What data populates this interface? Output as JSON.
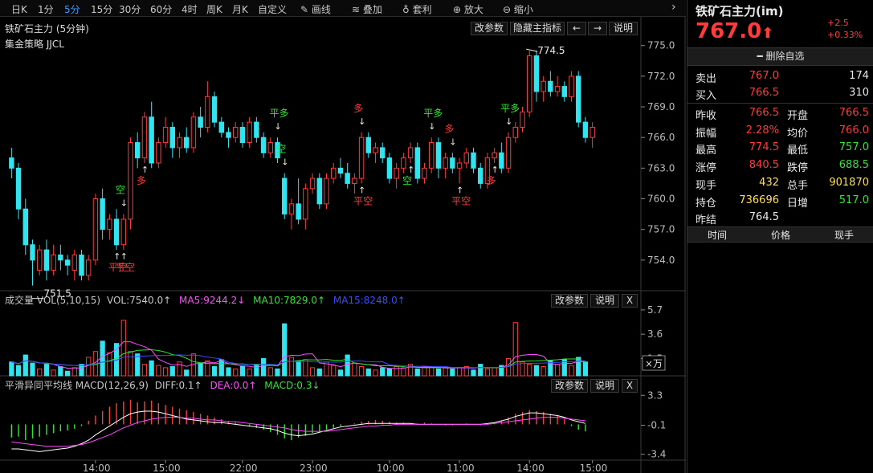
{
  "toolbar": {
    "items": [
      "日K",
      "1分",
      "5分",
      "15分",
      "30分",
      "60分",
      "4时",
      "周K",
      "月K",
      "自定义"
    ],
    "active_index": 2,
    "tools": [
      {
        "label": "画线",
        "icon": "pencil-icon"
      },
      {
        "label": "叠加",
        "icon": "stack-icon"
      },
      {
        "label": "套利",
        "icon": "moneybag-icon"
      },
      {
        "label": "放大",
        "icon": "zoom-in-icon"
      },
      {
        "label": "缩小",
        "icon": "zoom-out-icon"
      }
    ],
    "collapse_icon": "chevron-right-icon"
  },
  "main_panel": {
    "title": "铁矿石主力 (5分钟)",
    "strategy": "集金策略 JJCL",
    "buttons": {
      "params": "改参数",
      "hide_indicator": "隐藏主指标",
      "prev": "←",
      "next": "→",
      "help": "说明"
    }
  },
  "volume_panel": {
    "legend": [
      {
        "text": "成交量 VOL(5,10,15)",
        "color": "#dcdcdc"
      },
      {
        "text": "VOL:7540.0↑",
        "color": "#dcdcdc"
      },
      {
        "text": "MA5:9244.2↓",
        "color": "#ff4cff"
      },
      {
        "text": "MA10:7829.0↑",
        "color": "#2ee82e"
      },
      {
        "text": "MA15:8248.0↑",
        "color": "#3a4cff"
      }
    ],
    "buttons": {
      "params": "改参数",
      "help": "说明",
      "close": "X"
    },
    "unit": "×万"
  },
  "macd_panel": {
    "legend": [
      {
        "text": "平滑异同平均线 MACD(12,26,9)",
        "color": "#dcdcdc"
      },
      {
        "text": "DIFF:0.1↑",
        "color": "#dcdcdc"
      },
      {
        "text": "DEA:0.0↑",
        "color": "#ff4cff"
      },
      {
        "text": "MACD:0.3↓",
        "color": "#2ee82e"
      }
    ],
    "buttons": {
      "params": "改参数",
      "help": "说明",
      "close": "X"
    }
  },
  "chart_data": {
    "type": "candlestick",
    "price_axis": {
      "ticks": [
        "775.0",
        "772.0",
        "769.0",
        "766.0",
        "763.0",
        "760.0",
        "757.0",
        "754.0"
      ],
      "ylim": [
        751,
        776
      ]
    },
    "volume_axis": {
      "ticks": [
        "5.7",
        "3.6",
        "1.5"
      ]
    },
    "macd_axis": {
      "ticks": [
        "3.3",
        "-0.1",
        "-3.4"
      ]
    },
    "time_axis": [
      "14:00",
      "15:00",
      "22:00",
      "23:00",
      "10:00",
      "11:00",
      "14:00",
      "15:00"
    ],
    "annotations": {
      "high": "774.5",
      "low": "751.5"
    },
    "signals": [
      {
        "text": "平空",
        "color": "#ff3b3b"
      },
      {
        "text": "空",
        "color": "#2ee82e"
      },
      {
        "text": "平空",
        "color": "#ff3b3b"
      },
      {
        "text": "多",
        "color": "#ff3b3b"
      },
      {
        "text": "平多",
        "color": "#2ee82e"
      },
      {
        "text": "空",
        "color": "#2ee82e"
      },
      {
        "text": "多",
        "color": "#ff3b3b"
      },
      {
        "text": "平空",
        "color": "#ff3b3b"
      },
      {
        "text": "空",
        "color": "#2ee82e"
      },
      {
        "text": "平多",
        "color": "#2ee82e"
      },
      {
        "text": "多",
        "color": "#ff3b3b"
      },
      {
        "text": "平空",
        "color": "#ff3b3b"
      },
      {
        "text": "平多",
        "color": "#2ee82e"
      },
      {
        "text": "多",
        "color": "#ff3b3b"
      }
    ],
    "candles": [
      {
        "o": 764.0,
        "h": 765.0,
        "l": 762.0,
        "c": 763.0
      },
      {
        "o": 763.0,
        "h": 763.5,
        "l": 758.0,
        "c": 759.0
      },
      {
        "o": 759.0,
        "h": 760.0,
        "l": 754.5,
        "c": 755.5
      },
      {
        "o": 755.5,
        "h": 756.0,
        "l": 751.5,
        "c": 754.0
      },
      {
        "o": 753.0,
        "h": 755.5,
        "l": 752.5,
        "c": 755.0
      },
      {
        "o": 755.0,
        "h": 756.0,
        "l": 752.0,
        "c": 753.0
      },
      {
        "o": 753.0,
        "h": 755.5,
        "l": 752.5,
        "c": 754.5
      },
      {
        "o": 754.5,
        "h": 755.5,
        "l": 753.0,
        "c": 754.0
      },
      {
        "o": 754.0,
        "h": 754.5,
        "l": 752.5,
        "c": 753.5
      },
      {
        "o": 753.0,
        "h": 755.0,
        "l": 752.0,
        "c": 754.5
      },
      {
        "o": 754.5,
        "h": 755.0,
        "l": 752.0,
        "c": 752.5
      },
      {
        "o": 752.5,
        "h": 754.5,
        "l": 752.0,
        "c": 754.0
      },
      {
        "o": 754.0,
        "h": 760.5,
        "l": 753.5,
        "c": 760.0
      },
      {
        "o": 760.0,
        "h": 761.0,
        "l": 756.0,
        "c": 757.0
      },
      {
        "o": 757.0,
        "h": 758.5,
        "l": 756.0,
        "c": 758.0
      },
      {
        "o": 758.0,
        "h": 759.0,
        "l": 755.0,
        "c": 755.5
      },
      {
        "o": 755.5,
        "h": 758.5,
        "l": 755.0,
        "c": 758.0
      },
      {
        "o": 758.0,
        "h": 766.0,
        "l": 757.0,
        "c": 765.5
      },
      {
        "o": 765.5,
        "h": 766.5,
        "l": 763.0,
        "c": 764.0
      },
      {
        "o": 764.0,
        "h": 768.5,
        "l": 763.5,
        "c": 768.0
      },
      {
        "o": 768.0,
        "h": 769.5,
        "l": 763.0,
        "c": 763.5
      },
      {
        "o": 763.5,
        "h": 766.0,
        "l": 763.0,
        "c": 765.5
      },
      {
        "o": 765.5,
        "h": 768.0,
        "l": 765.0,
        "c": 767.0
      },
      {
        "o": 767.0,
        "h": 767.5,
        "l": 764.0,
        "c": 765.0
      },
      {
        "o": 765.0,
        "h": 766.5,
        "l": 764.0,
        "c": 766.0
      },
      {
        "o": 766.0,
        "h": 767.0,
        "l": 764.5,
        "c": 765.0
      },
      {
        "o": 765.0,
        "h": 768.5,
        "l": 764.5,
        "c": 768.0
      },
      {
        "o": 768.0,
        "h": 769.0,
        "l": 766.0,
        "c": 767.0
      },
      {
        "o": 767.0,
        "h": 771.5,
        "l": 766.5,
        "c": 770.0
      },
      {
        "o": 770.0,
        "h": 770.5,
        "l": 767.0,
        "c": 767.5
      },
      {
        "o": 767.5,
        "h": 768.0,
        "l": 766.0,
        "c": 766.5
      },
      {
        "o": 766.5,
        "h": 767.0,
        "l": 765.0,
        "c": 766.0
      },
      {
        "o": 766.0,
        "h": 767.5,
        "l": 765.5,
        "c": 767.0
      },
      {
        "o": 767.0,
        "h": 767.5,
        "l": 765.0,
        "c": 765.5
      },
      {
        "o": 765.5,
        "h": 768.0,
        "l": 765.0,
        "c": 767.5
      },
      {
        "o": 767.5,
        "h": 768.0,
        "l": 765.5,
        "c": 766.0
      },
      {
        "o": 766.0,
        "h": 766.5,
        "l": 764.0,
        "c": 764.5
      },
      {
        "o": 764.5,
        "h": 766.0,
        "l": 764.0,
        "c": 765.5
      },
      {
        "o": 765.5,
        "h": 766.0,
        "l": 763.5,
        "c": 764.0
      },
      {
        "o": 762.0,
        "h": 762.5,
        "l": 758.0,
        "c": 758.5
      },
      {
        "o": 758.5,
        "h": 760.0,
        "l": 757.0,
        "c": 759.5
      },
      {
        "o": 759.5,
        "h": 762.0,
        "l": 757.5,
        "c": 758.0
      },
      {
        "o": 758.0,
        "h": 761.5,
        "l": 757.0,
        "c": 761.0
      },
      {
        "o": 761.0,
        "h": 762.5,
        "l": 760.5,
        "c": 762.0
      },
      {
        "o": 762.0,
        "h": 762.5,
        "l": 759.0,
        "c": 759.5
      },
      {
        "o": 759.5,
        "h": 762.5,
        "l": 759.0,
        "c": 762.0
      },
      {
        "o": 762.0,
        "h": 763.5,
        "l": 761.5,
        "c": 763.0
      },
      {
        "o": 763.0,
        "h": 764.0,
        "l": 762.0,
        "c": 762.5
      },
      {
        "o": 762.5,
        "h": 763.5,
        "l": 761.0,
        "c": 761.5
      },
      {
        "o": 761.5,
        "h": 762.5,
        "l": 760.5,
        "c": 762.0
      },
      {
        "o": 762.0,
        "h": 766.5,
        "l": 761.5,
        "c": 766.0
      },
      {
        "o": 766.0,
        "h": 766.5,
        "l": 764.0,
        "c": 764.5
      },
      {
        "o": 764.5,
        "h": 765.5,
        "l": 763.5,
        "c": 765.0
      },
      {
        "o": 765.0,
        "h": 765.5,
        "l": 763.5,
        "c": 764.0
      },
      {
        "o": 764.0,
        "h": 764.5,
        "l": 761.5,
        "c": 762.0
      },
      {
        "o": 762.0,
        "h": 763.5,
        "l": 761.0,
        "c": 763.0
      },
      {
        "o": 763.0,
        "h": 764.5,
        "l": 762.5,
        "c": 764.0
      },
      {
        "o": 764.0,
        "h": 765.5,
        "l": 763.5,
        "c": 765.0
      },
      {
        "o": 765.0,
        "h": 765.5,
        "l": 761.5,
        "c": 762.0
      },
      {
        "o": 762.0,
        "h": 763.5,
        "l": 761.5,
        "c": 763.0
      },
      {
        "o": 763.0,
        "h": 766.0,
        "l": 762.5,
        "c": 765.5
      },
      {
        "o": 765.5,
        "h": 766.0,
        "l": 762.0,
        "c": 763.0
      },
      {
        "o": 763.0,
        "h": 764.5,
        "l": 762.0,
        "c": 764.0
      },
      {
        "o": 764.0,
        "h": 764.5,
        "l": 762.5,
        "c": 763.0
      },
      {
        "o": 763.0,
        "h": 764.0,
        "l": 761.5,
        "c": 763.5
      },
      {
        "o": 763.5,
        "h": 765.0,
        "l": 763.0,
        "c": 764.5
      },
      {
        "o": 764.5,
        "h": 765.0,
        "l": 762.5,
        "c": 763.0
      },
      {
        "o": 763.0,
        "h": 763.5,
        "l": 761.0,
        "c": 761.5
      },
      {
        "o": 761.5,
        "h": 764.5,
        "l": 761.0,
        "c": 764.0
      },
      {
        "o": 764.0,
        "h": 765.0,
        "l": 763.5,
        "c": 764.5
      },
      {
        "o": 764.5,
        "h": 765.5,
        "l": 762.5,
        "c": 763.0
      },
      {
        "o": 763.0,
        "h": 766.5,
        "l": 762.5,
        "c": 766.0
      },
      {
        "o": 766.0,
        "h": 767.5,
        "l": 765.5,
        "c": 767.0
      },
      {
        "o": 767.0,
        "h": 769.0,
        "l": 766.5,
        "c": 768.5
      },
      {
        "o": 768.5,
        "h": 774.5,
        "l": 768.0,
        "c": 774.0
      },
      {
        "o": 774.0,
        "h": 774.5,
        "l": 769.5,
        "c": 770.5
      },
      {
        "o": 770.5,
        "h": 772.0,
        "l": 769.5,
        "c": 771.5
      },
      {
        "o": 771.5,
        "h": 772.5,
        "l": 770.0,
        "c": 770.5
      },
      {
        "o": 770.5,
        "h": 772.0,
        "l": 770.0,
        "c": 771.0
      },
      {
        "o": 771.0,
        "h": 771.5,
        "l": 769.5,
        "c": 770.0
      },
      {
        "o": 770.0,
        "h": 772.5,
        "l": 769.5,
        "c": 772.0
      },
      {
        "o": 772.0,
        "h": 772.5,
        "l": 767.0,
        "c": 767.5
      },
      {
        "o": 767.5,
        "h": 768.0,
        "l": 765.5,
        "c": 766.0
      },
      {
        "o": 766.0,
        "h": 767.5,
        "l": 765.0,
        "c": 767.0
      }
    ],
    "volumes": [
      1.2,
      0.9,
      1.8,
      1.1,
      0.6,
      1.0,
      0.5,
      0.8,
      0.4,
      0.7,
      1.0,
      1.6,
      2.1,
      3.0,
      2.0,
      2.8,
      4.8,
      2.1,
      1.9,
      1.0,
      1.3,
      0.9,
      0.7,
      0.8,
      1.2,
      0.5,
      1.9,
      1.1,
      1.3,
      0.8,
      1.4,
      0.7,
      0.6,
      0.8,
      0.6,
      0.9,
      1.5,
      0.7,
      0.6,
      4.5,
      1.6,
      1.3,
      1.4,
      0.7,
      0.6,
      1.2,
      0.9,
      0.5,
      1.8,
      1.1,
      0.8,
      0.6,
      0.5,
      0.7,
      0.6,
      0.8,
      0.7,
      1.0,
      0.6,
      0.7,
      0.8,
      0.6,
      0.7,
      0.6,
      0.7,
      0.8,
      0.5,
      1.0,
      0.6,
      0.7,
      0.9,
      1.5,
      4.6,
      1.2,
      1.0,
      0.9,
      0.8,
      1.3,
      1.0,
      1.4,
      0.9,
      1.6,
      1.2
    ],
    "macd": [
      -1.5,
      -1.4,
      -1.8,
      -1.6,
      -1.4,
      -1.2,
      -1.0,
      -0.8,
      -0.7,
      -0.5,
      -0.2,
      0.4,
      1.0,
      1.5,
      2.0,
      2.4,
      2.6,
      2.8,
      2.5,
      2.6,
      2.7,
      2.4,
      2.2,
      2.0,
      1.8,
      1.6,
      1.4,
      1.2,
      1.0,
      0.8,
      0.6,
      0.4,
      0.2,
      0.0,
      -0.2,
      -0.4,
      -0.6,
      -0.9,
      -1.2,
      -1.6,
      -1.8,
      -1.5,
      -1.3,
      -1.0,
      -0.8,
      -0.6,
      -0.4,
      -0.2,
      0.0,
      0.1,
      0.3,
      0.4,
      0.5,
      0.4,
      0.3,
      0.2,
      0.2,
      0.1,
      0.1,
      0.2,
      0.1,
      0.0,
      -0.1,
      -0.1,
      0.0,
      0.1,
      0.0,
      -0.1,
      0.1,
      0.2,
      0.4,
      0.8,
      1.2,
      1.4,
      1.6,
      1.5,
      1.4,
      1.2,
      1.0,
      0.6,
      -0.2,
      -0.6,
      -0.8
    ],
    "diff": [
      -2.8,
      -2.8,
      -2.9,
      -3.0,
      -3.1,
      -3.0,
      -2.9,
      -2.8,
      -2.7,
      -2.5,
      -2.2,
      -1.8,
      -1.2,
      -0.7,
      -0.2,
      0.3,
      0.8,
      1.2,
      1.4,
      1.5,
      1.5,
      1.4,
      1.2,
      1.0,
      0.8,
      0.6,
      0.5,
      0.4,
      0.3,
      0.2,
      0.2,
      0.1,
      0.0,
      -0.1,
      -0.2,
      -0.3,
      -0.4,
      -0.5,
      -0.7,
      -1.0,
      -1.2,
      -1.3,
      -1.2,
      -1.1,
      -0.9,
      -0.7,
      -0.5,
      -0.3,
      -0.2,
      -0.1,
      0.0,
      0.1,
      0.1,
      0.1,
      0.1,
      0.1,
      0.1,
      0.1,
      0.0,
      0.0,
      0.0,
      0.0,
      0.0,
      0.0,
      0.0,
      0.0,
      0.0,
      0.0,
      0.1,
      0.2,
      0.4,
      0.6,
      0.9,
      1.1,
      1.3,
      1.3,
      1.2,
      1.1,
      1.0,
      0.8,
      0.5,
      0.3,
      0.1
    ],
    "dea": [
      -2.0,
      -2.1,
      -2.2,
      -2.3,
      -2.4,
      -2.5,
      -2.5,
      -2.5,
      -2.5,
      -2.4,
      -2.3,
      -2.1,
      -1.8,
      -1.5,
      -1.2,
      -0.8,
      -0.4,
      -0.1,
      0.2,
      0.4,
      0.6,
      0.7,
      0.8,
      0.8,
      0.8,
      0.7,
      0.7,
      0.6,
      0.5,
      0.5,
      0.4,
      0.3,
      0.3,
      0.2,
      0.1,
      0.0,
      -0.1,
      -0.2,
      -0.3,
      -0.4,
      -0.6,
      -0.7,
      -0.8,
      -0.8,
      -0.8,
      -0.8,
      -0.7,
      -0.6,
      -0.5,
      -0.4,
      -0.3,
      -0.2,
      -0.2,
      -0.1,
      -0.1,
      0.0,
      0.0,
      0.0,
      0.0,
      0.0,
      0.0,
      0.0,
      0.0,
      0.0,
      0.0,
      0.0,
      0.0,
      0.0,
      0.0,
      0.1,
      0.2,
      0.3,
      0.4,
      0.5,
      0.6,
      0.7,
      0.8,
      0.8,
      0.8,
      0.7,
      0.6,
      0.5,
      0.4
    ]
  },
  "quote": {
    "name": "铁矿石主力(im)",
    "price": "767.0",
    "change": "+2.5",
    "change_pct": "+0.33%",
    "remove_watch": "删除自选",
    "rows": [
      {
        "k1": "卖出",
        "v1": "767.0",
        "c1": "red",
        "v2": "174",
        "c2": "white"
      },
      {
        "k1": "买入",
        "v1": "766.5",
        "c1": "red",
        "v2": "310",
        "c2": "white"
      },
      {
        "k1": "昨收",
        "v1": "766.5",
        "c1": "red",
        "k2": "开盘",
        "v2": "766.5",
        "c2": "red"
      },
      {
        "k1": "振幅",
        "v1": "2.28%",
        "c1": "red",
        "k2": "均价",
        "v2": "766.0",
        "c2": "red"
      },
      {
        "k1": "最高",
        "v1": "774.5",
        "c1": "red",
        "k2": "最低",
        "v2": "757.0",
        "c2": "green"
      },
      {
        "k1": "涨停",
        "v1": "840.5",
        "c1": "red",
        "k2": "跌停",
        "v2": "688.5",
        "c2": "green"
      },
      {
        "k1": "现手",
        "v1": "432",
        "c1": "yellow",
        "k2": "总手",
        "v2": "901870",
        "c2": "yellow"
      },
      {
        "k1": "持仓",
        "v1": "736696",
        "c1": "yellow",
        "k2": "日增",
        "v2": "517.0",
        "c2": "green"
      },
      {
        "k1": "昨结",
        "v1": "764.5",
        "c1": "white"
      }
    ],
    "tick_headers": [
      "时间",
      "价格",
      "现手"
    ]
  }
}
